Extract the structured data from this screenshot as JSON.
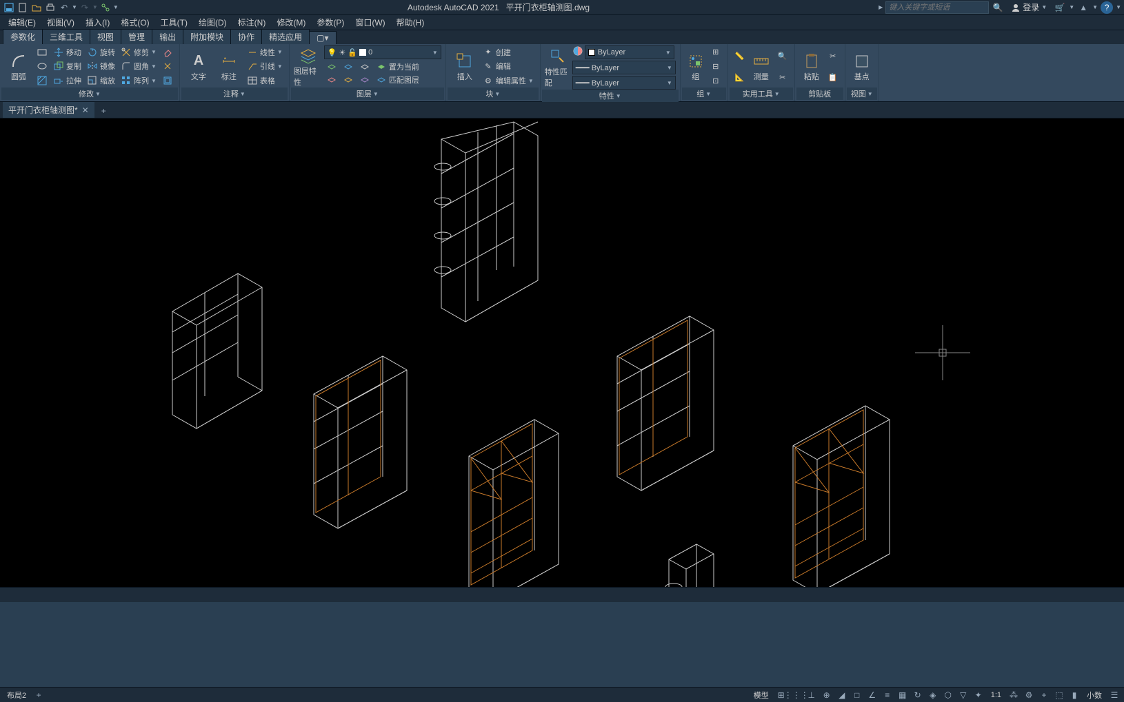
{
  "title": {
    "app": "Autodesk AutoCAD 2021",
    "file": "平开门衣柜轴测图.dwg"
  },
  "search": {
    "placeholder": "键入关键字或短语"
  },
  "login": {
    "label": "登录"
  },
  "menu": {
    "items": [
      "编辑(E)",
      "视图(V)",
      "插入(I)",
      "格式(O)",
      "工具(T)",
      "绘图(D)",
      "标注(N)",
      "修改(M)",
      "参数(P)",
      "窗口(W)",
      "帮助(H)"
    ]
  },
  "ribbon_tabs": [
    "参数化",
    "三维工具",
    "视图",
    "管理",
    "输出",
    "附加模块",
    "协作",
    "精选应用"
  ],
  "panels": {
    "modify": {
      "title": "修改",
      "arc_label": "圆弧",
      "move": "移动",
      "rotate": "旋转",
      "trim": "修剪",
      "copy": "复制",
      "mirror": "镜像",
      "fillet": "圆角",
      "stretch": "拉伸",
      "scale": "缩放",
      "array": "阵列"
    },
    "annotate": {
      "title": "注释",
      "text": "文字",
      "dim": "标注",
      "linear": "线性",
      "leader": "引线",
      "table": "表格"
    },
    "layer": {
      "title": "图层",
      "props": "图层特性",
      "current_layer": "0",
      "current": "置为当前",
      "match": "匹配图层"
    },
    "block": {
      "title": "块",
      "insert": "插入",
      "create": "创建",
      "edit": "编辑",
      "editattr": "编辑属性"
    },
    "properties": {
      "title": "特性",
      "match": "特性匹配",
      "layer_color": "ByLayer",
      "linetype": "ByLayer",
      "lineweight": "ByLayer"
    },
    "group": {
      "title": "组",
      "label": "组"
    },
    "utilities": {
      "title": "实用工具",
      "measure": "测量"
    },
    "clipboard": {
      "title": "剪贴板",
      "paste": "粘贴"
    },
    "view": {
      "title": "视图",
      "base": "基点"
    }
  },
  "file_tab": {
    "name": "平开门衣柜轴测图*"
  },
  "statusbar": {
    "layout": "布局2",
    "model": "模型",
    "scale": "1:1",
    "units": "小数"
  }
}
